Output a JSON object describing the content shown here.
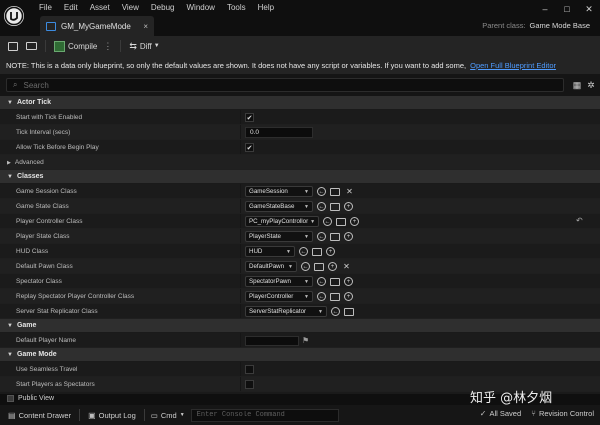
{
  "menu": [
    "File",
    "Edit",
    "Asset",
    "View",
    "Debug",
    "Window",
    "Tools",
    "Help"
  ],
  "window_controls": [
    "minimize-icon",
    "maximize-icon",
    "close-icon"
  ],
  "tab": {
    "label": "GM_MyGameMode",
    "close": "×"
  },
  "parent_class": {
    "label": "Parent class:",
    "value": "Game Mode Base"
  },
  "toolbar": {
    "compile_label": "Compile",
    "diff_label": "Diff"
  },
  "notice": {
    "text": "NOTE: This is a data only blueprint, so only the default values are shown.  It does not have any script or variables.  If you want to add some,",
    "link": "Open Full Blueprint Editor"
  },
  "search": {
    "placeholder": "Search"
  },
  "sections": {
    "actor_tick": {
      "title": "Actor Tick",
      "rows": [
        {
          "label": "Start with Tick Enabled",
          "checked": true
        },
        {
          "label": "Tick Interval (secs)",
          "value": "0.0"
        },
        {
          "label": "Allow Tick Before Begin Play",
          "checked": true
        }
      ],
      "advanced": "Advanced"
    },
    "classes": {
      "title": "Classes",
      "rows": [
        {
          "label": "Game Session Class",
          "value": "GameSession"
        },
        {
          "label": "Game State Class",
          "value": "GameStateBase"
        },
        {
          "label": "Player Controller Class",
          "value": "PC_myPlayControllor"
        },
        {
          "label": "Player State Class",
          "value": "PlayerState"
        },
        {
          "label": "HUD Class",
          "value": "HUD"
        },
        {
          "label": "Default Pawn Class",
          "value": "DefaultPawn"
        },
        {
          "label": "Spectator Class",
          "value": "SpectatorPawn"
        },
        {
          "label": "Replay Spectator Player Controller Class",
          "value": "PlayerController"
        },
        {
          "label": "Server Stat Replicator Class",
          "value": "ServerStatReplicator"
        }
      ]
    },
    "game": {
      "title": "Game",
      "rows": [
        {
          "label": "Default Player Name",
          "value": ""
        }
      ]
    },
    "game_mode": {
      "title": "Game Mode",
      "rows": [
        {
          "label": "Use Seamless Travel",
          "checked": false
        },
        {
          "label": "Start Players as Spectators",
          "checked": false
        }
      ]
    }
  },
  "public_view": "Public View",
  "bottom": {
    "content_drawer": "Content Drawer",
    "output_log": "Output Log",
    "cmd": "Cmd",
    "console_placeholder": "Enter Console Command",
    "all_saved": "All Saved",
    "revision_control": "Revision Control"
  },
  "watermark": "知乎 @林夕烟"
}
